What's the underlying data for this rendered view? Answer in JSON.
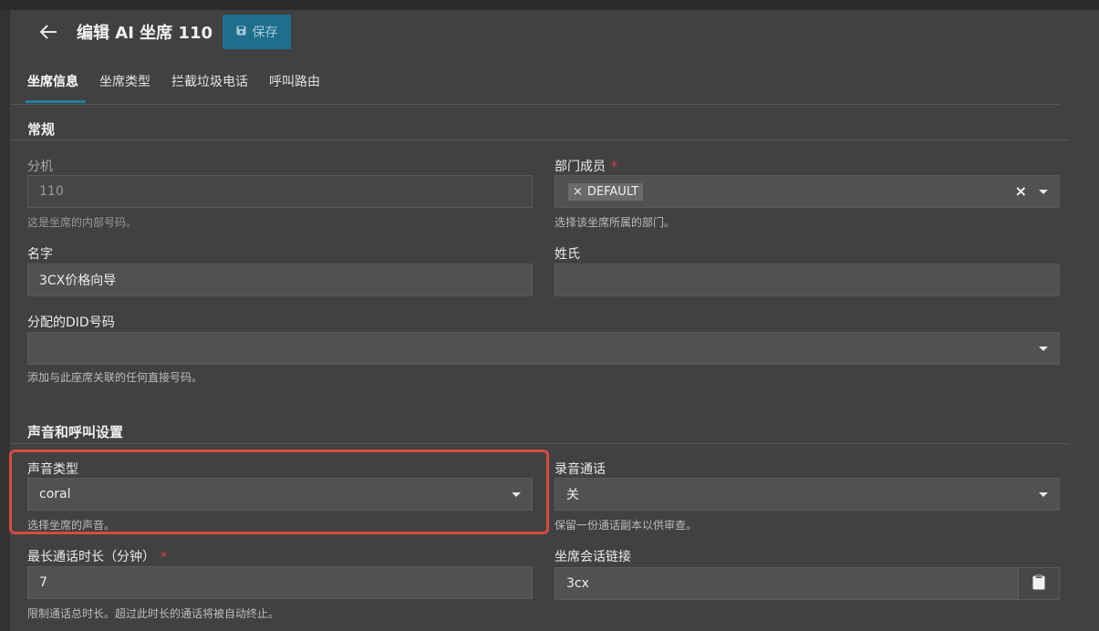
{
  "header": {
    "title": "编辑 AI 坐席 110",
    "save_label": "保存"
  },
  "tabs": [
    {
      "label": "坐席信息",
      "active": true
    },
    {
      "label": "坐席类型"
    },
    {
      "label": "拦截垃圾电话"
    },
    {
      "label": "呼叫路由"
    }
  ],
  "general": {
    "section_title": "常规",
    "extension": {
      "label": "分机",
      "value": "110",
      "help": "这是坐席的内部号码。"
    },
    "department": {
      "label": "部门成员",
      "required": "*",
      "tag_remove": "×",
      "tag": "DEFAULT",
      "clear": "×",
      "help": "选择该坐席所属的部门。"
    },
    "first_name": {
      "label": "名字",
      "value": "3CX价格向导"
    },
    "last_name": {
      "label": "姓氏",
      "value": ""
    },
    "did": {
      "label": "分配的DID号码",
      "value": "",
      "help": "添加与此座席关联的任何直接号码。"
    }
  },
  "voice": {
    "section_title": "声音和呼叫设置",
    "voice_type": {
      "label": "声音类型",
      "value": "coral",
      "help": "选择坐席的声音。"
    },
    "record": {
      "label": "录音通话",
      "value": "关",
      "help": "保留一份通话副本以供审查。"
    },
    "max_duration": {
      "label": "最长通话时长（分钟）",
      "required": "*",
      "value": "7",
      "help": "限制通话总时长。超过此时长的通话将被自动终止。"
    },
    "session_link": {
      "label": "坐席会话链接",
      "value": "3cx"
    }
  },
  "colors": {
    "accent": "#1e7fa3",
    "highlight": "#d94a3f",
    "required": "#e0403a"
  }
}
